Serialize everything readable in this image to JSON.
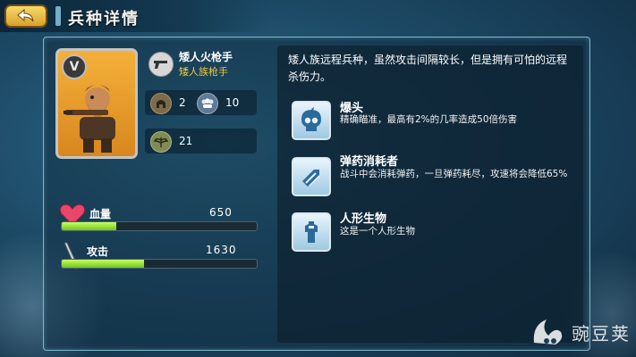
{
  "header": {
    "title": "兵种详情"
  },
  "unit": {
    "rank": "V",
    "name": "矮人火枪手",
    "class": "矮人族枪手",
    "stats": {
      "defense_a": "2",
      "defense_b": "10",
      "speed": "21"
    }
  },
  "bars": [
    {
      "label": "血量",
      "value": "650",
      "fill": 0.28
    },
    {
      "label": "攻击",
      "value": "1630",
      "fill": 0.42
    }
  ],
  "description": "矮人族远程兵种，虽然攻击间隔较长，但是拥有可怕的远程杀伤力。",
  "skills": [
    {
      "name": "爆头",
      "desc": "精确瞄准，最高有2%的几率造成50倍伤害",
      "icon": "skull-icon"
    },
    {
      "name": "弹药消耗者",
      "desc": "战斗中会消耗弹药，一旦弹药耗尽，攻速将会降低65%",
      "icon": "ammo-icon"
    },
    {
      "name": "人形生物",
      "desc": "这是一个人形生物",
      "icon": "humanoid-icon"
    }
  ],
  "watermark": {
    "text": "豌豆荚"
  },
  "colors": {
    "accent": "#f0c840",
    "bar_fill": "#9ae23a",
    "frame": "#7fb7c9"
  }
}
